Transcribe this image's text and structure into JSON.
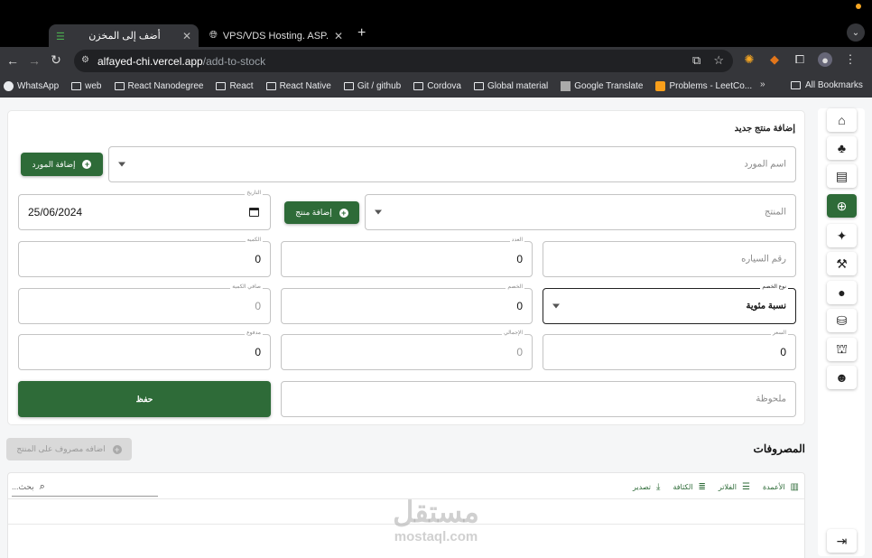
{
  "browser": {
    "tabs": [
      {
        "title": "أضف إلى المخزن",
        "active": true
      },
      {
        "title": "VPS/VDS Hosting. ASP.Net M",
        "active": false
      }
    ],
    "url_domain": "alfayed-chi.vercel.app",
    "url_path": "/add-to-stock",
    "bookmarks": [
      "WhatsApp",
      "web",
      "React Nanodegree",
      "React",
      "React Native",
      "Git / github",
      "Cordova",
      "Global material",
      "Google Translate",
      "Problems - LeetCo..."
    ],
    "all_bookmarks": "All Bookmarks"
  },
  "form": {
    "title": "إضافة منتج جديد",
    "supplier_placeholder": "اسم المورد",
    "add_supplier_label": "إضافة المورد",
    "date_label": "التاريخ",
    "date_value": "25/06/2024",
    "add_product_label": "إضافة منتج",
    "product_placeholder": "المنتج",
    "quantity_label": "الكميه",
    "quantity_value": "0",
    "count_label": "العدد",
    "count_value": "0",
    "car_number_placeholder": "رقم السياره",
    "net_quantity_label": "صافي الكمية",
    "net_quantity_value": "0",
    "discount_label": "الخصم",
    "discount_value": "0",
    "discount_type_label": "نوع الخصم",
    "discount_type_value": "نسبة مئوية",
    "paid_label": "مدفوع",
    "paid_value": "0",
    "total_label": "الإجمالي",
    "total_value": "0",
    "price_label": "السعر",
    "price_value": "0",
    "save_label": "حفظ",
    "note_placeholder": "ملحوظة"
  },
  "expenses": {
    "add_expense_label": "اضافه مصروف على المنتج",
    "title": "المصروفات",
    "toolbar": {
      "columns": "الأعمدة",
      "filters": "الفلاتر",
      "density": "الكثافة",
      "export": "تصدير"
    },
    "search_placeholder": "بحث..."
  },
  "watermark": {
    "arabic": "مستقل",
    "latin": "mostaql.com"
  },
  "colors": {
    "primary": "#2e6b38"
  }
}
